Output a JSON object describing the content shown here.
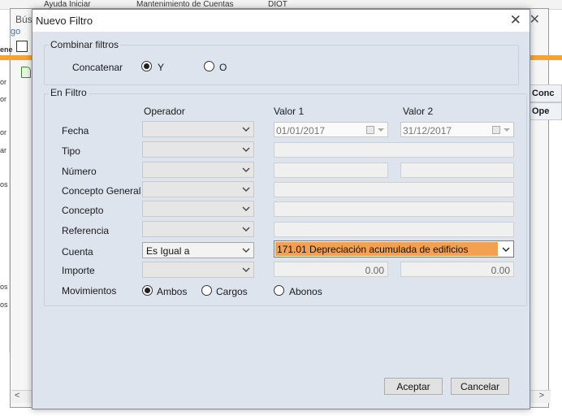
{
  "background": {
    "toolbar_items": [
      "Ayuda Iniciar",
      "Mantenimiento de Cuentas",
      "DIOT"
    ],
    "window_title": "Bús",
    "window_subtitle": "go",
    "left_labels": [
      "ene",
      "or",
      "or",
      "or",
      "ar",
      "os",
      "os",
      "os"
    ],
    "right_headers": [
      "Conc",
      "Ope"
    ]
  },
  "dialog": {
    "title": "Nuevo Filtro",
    "combinar": {
      "group_title": "Combinar filtros",
      "label": "Concatenar",
      "options": [
        "Y",
        "O"
      ],
      "selected": "Y"
    },
    "filtro": {
      "group_title": "En Filtro",
      "col_operador": "Operador",
      "col_valor1": "Valor 1",
      "col_valor2": "Valor 2",
      "rows": {
        "fecha": {
          "label": "Fecha",
          "operador": "",
          "valor1": "01/01/2017",
          "valor2": "31/12/2017"
        },
        "tipo": {
          "label": "Tipo",
          "operador": "",
          "valor1": ""
        },
        "numero": {
          "label": "Número",
          "operador": "",
          "valor1": "",
          "valor2": ""
        },
        "concepto_general": {
          "label": "Concepto General",
          "operador": "",
          "valor1": ""
        },
        "concepto": {
          "label": "Concepto",
          "operador": "",
          "valor1": ""
        },
        "referencia": {
          "label": "Referencia",
          "operador": "",
          "valor1": ""
        },
        "cuenta": {
          "label": "Cuenta",
          "operador": "Es Igual a",
          "valor1": "171.01 Depreciación acumulada de edificios"
        },
        "importe": {
          "label": "Importe",
          "operador": "",
          "valor1": "0.00",
          "valor2": "0.00"
        }
      },
      "movimientos": {
        "label": "Movimientos",
        "options": [
          "Ambos",
          "Cargos",
          "Abonos"
        ],
        "selected": "Ambos"
      }
    },
    "buttons": {
      "aceptar": "Aceptar",
      "cancelar": "Cancelar"
    }
  }
}
